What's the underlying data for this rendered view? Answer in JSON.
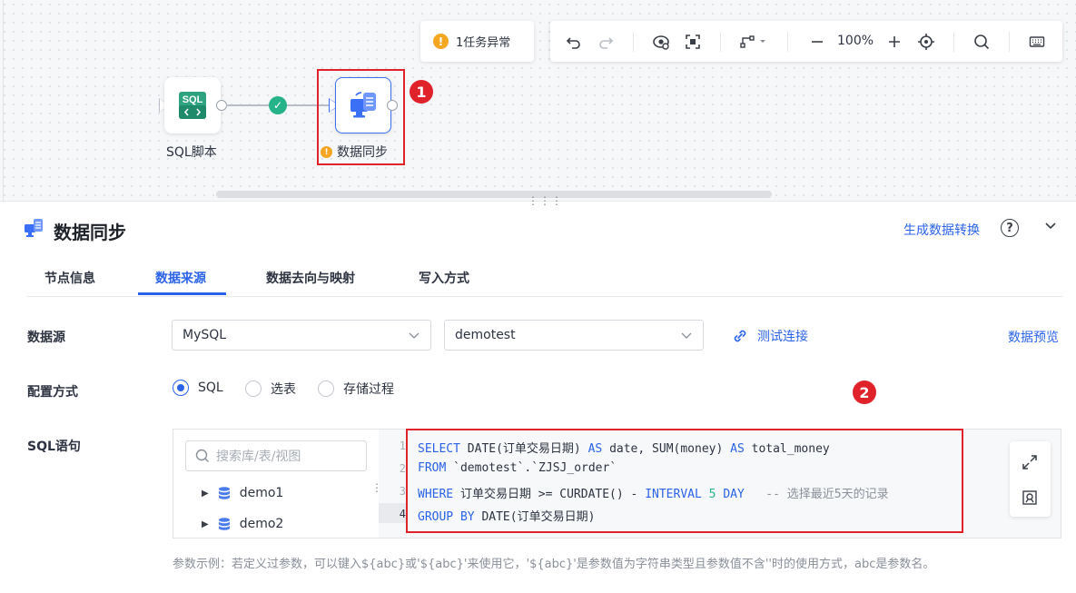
{
  "canvas": {
    "alert": {
      "icon": "warning-icon",
      "text": "1任务异常"
    },
    "toolbar": {
      "zoom": "100%",
      "icons": [
        "undo-icon",
        "redo-icon",
        "eye-icon",
        "fit-screen-icon",
        "layout-icon",
        "zoom-out-icon",
        "zoom-in-icon",
        "locate-icon",
        "search-icon",
        "keyboard-icon"
      ]
    },
    "nodes": [
      {
        "label": "SQL脚本",
        "icon_text": "SQL"
      },
      {
        "label": "数据同步",
        "status": "warning"
      }
    ],
    "annotations": [
      "1",
      "2"
    ]
  },
  "panel": {
    "title": "数据同步",
    "generate_link": "生成数据转换",
    "tabs": [
      "节点信息",
      "数据来源",
      "数据去向与映射",
      "写入方式"
    ],
    "active_tab": "数据来源",
    "datasource": {
      "label": "数据源",
      "type": "MySQL",
      "database": "demotest",
      "test_link": "测试连接",
      "preview_link": "数据预览"
    },
    "config": {
      "label": "配置方式",
      "options": [
        "SQL",
        "选表",
        "存储过程"
      ],
      "selected": "SQL"
    },
    "sql": {
      "label": "SQL语句",
      "search_placeholder": "搜索库/表/视图",
      "tree": [
        "demo1",
        "demo2"
      ],
      "line_numbers": [
        "1",
        "2",
        "3",
        "4"
      ],
      "lines": [
        "SELECT DATE(订单交易日期) AS date, SUM(money) AS total_money",
        "FROM `demotest`.`ZJSJ_order`",
        "WHERE 订单交易日期 >= CURDATE() - INTERVAL 5 DAY   -- 选择最近5天的记录",
        "GROUP BY DATE(订单交易日期)"
      ]
    },
    "hint": "参数示例：若定义过参数，可以键入${abc}或'${abc}'来使用它，'${abc}'是参数值为字符串类型且参数值不含''时的使用方式，abc是参数名。"
  },
  "colors": {
    "accent": "#2b63e8",
    "warning": "#f5a623",
    "success": "#27b38a",
    "annotation": "#e0232b"
  }
}
